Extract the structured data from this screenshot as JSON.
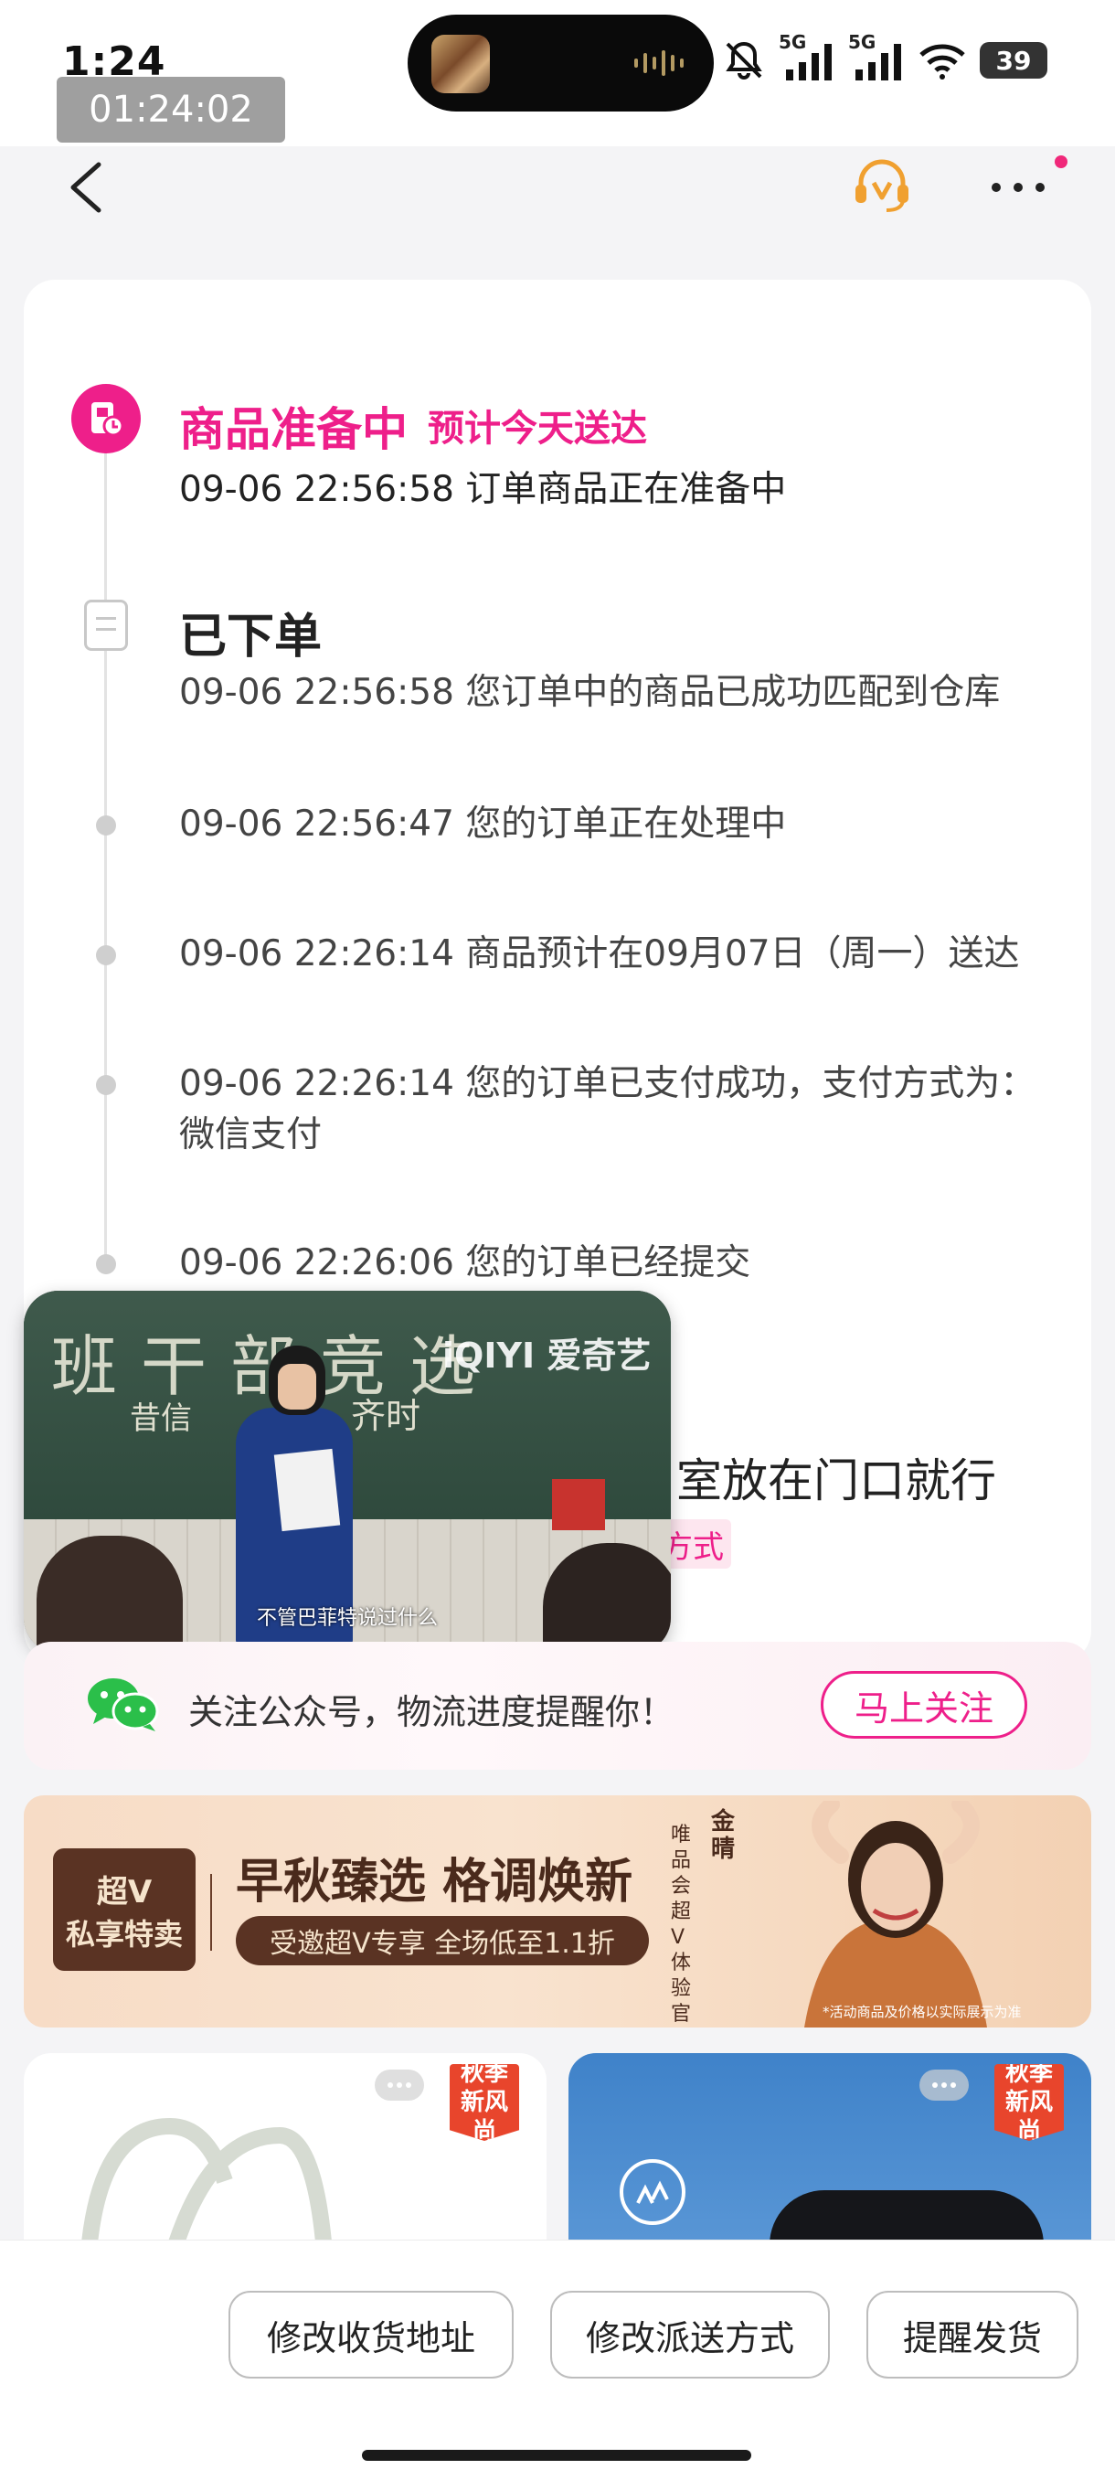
{
  "status_bar": {
    "time": "1:24",
    "recording_timer": "01:24:02",
    "network1": "5G",
    "network2": "5G",
    "battery": "39"
  },
  "header": {
    "back_icon": "chevron-left-icon",
    "service_icon": "headset-icon",
    "more_icon": "more-dots-icon"
  },
  "timeline": {
    "current": {
      "title": "商品准备中",
      "eta": "预计今天送达",
      "detail": "09-06 22:56:58 订单商品正在准备中"
    },
    "placed": {
      "title": "已下单",
      "detail": "09-06 22:56:58 您订单中的商品已成功匹配到仓库"
    },
    "events": [
      "09-06 22:56:47 您的订单正在处理中",
      "09-06 22:26:14 商品预计在09月07日（周一）送达",
      "09-06 22:26:14 您的订单已支付成功，支付方式为：微信支付",
      "09-06 22:26:06 您的订单已经提交"
    ],
    "partial_note": "室放在门口就行",
    "partial_tag": "方式"
  },
  "pip_video": {
    "board_title": "班干部竞选",
    "board_sub1": "昔信",
    "board_sub2": "齐时",
    "logo": "iQIYI 爱奇艺",
    "subtitle": "不管巴菲特说过什么"
  },
  "follow_banner": {
    "text": "关注公众号，物流进度提醒你！",
    "button": "马上关注"
  },
  "promo": {
    "badge_line1": "超V",
    "badge_line2": "私享特卖",
    "title": "早秋臻选 格调焕新",
    "pill": "受邀超V专享  全场低至1.1折",
    "vertical_name": "金晴",
    "vertical_role": "唯品会超V体验官",
    "footnote": "*活动商品及价格以实际展示为准"
  },
  "products": [
    {
      "tag_line1": "秋季",
      "tag_line2": "新风尚"
    },
    {
      "tag_line1": "秋季",
      "tag_line2": "新风尚"
    }
  ],
  "actions": {
    "edit_address": "修改收货地址",
    "edit_delivery": "修改派送方式",
    "remind_ship": "提醒发货"
  },
  "colors": {
    "accent": "#ee1f8a",
    "promo_brown": "#5a3323",
    "background": "#f4f4f6"
  }
}
